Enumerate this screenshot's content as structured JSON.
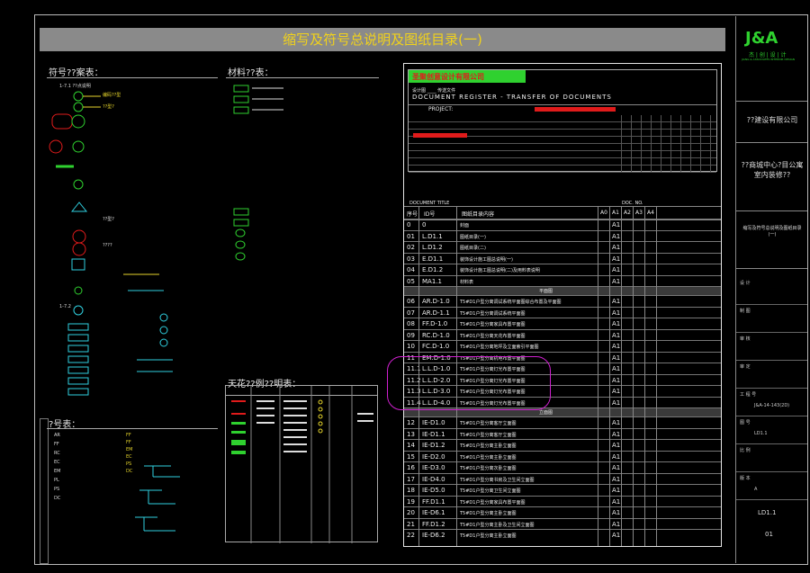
{
  "banner_title": "缩写及符号总说明及图纸目录(一)",
  "left": {
    "symbols_title": "符号??案表：",
    "materials_title": "材料??表：",
    "ceiling_title": "天花??例??明表：",
    "numbers_title": "?号表：",
    "sym_group_1": "1-7.1 ??点说明",
    "sym_group_2": "1-7.2",
    "sym_labels": [
      "编码??型",
      "??型?",
      "??型?",
      "????"
    ],
    "abbr_codes": [
      "AR",
      "FF",
      "RC",
      "EC",
      "EM",
      "PL",
      "PS",
      "DC"
    ],
    "abbr_codes_2": [
      "FF",
      "FF",
      "EM",
      "EC",
      "PS",
      "DC"
    ]
  },
  "register": {
    "company": "圣聚创意设计有限公司",
    "subtitle_cn": "设计图 ____ 传送文件",
    "title_en": "DOCUMENT REGISTER - TRANSFER OF DOCUMENTS",
    "project_label": "PROJECT:",
    "doc_title_label": "DOCUMENT TITLE",
    "doc_no_label": "DOC. NO.",
    "header_cols": [
      "序号",
      "ID号",
      "图纸目录内容",
      "A0",
      "A1",
      "A2",
      "A3",
      "A4"
    ],
    "rows": [
      {
        "n": "0",
        "id": "0",
        "desc": "封面",
        "size": "A1"
      },
      {
        "n": "01",
        "id": "L.D1.1",
        "desc": "图纸目录(一)",
        "size": "A1"
      },
      {
        "n": "02",
        "id": "L.D1.2",
        "desc": "图纸目录(二)",
        "size": "A1"
      },
      {
        "n": "03",
        "id": "E.D1.1",
        "desc": "装饰设计施工图总说明(一)",
        "size": "A1"
      },
      {
        "n": "04",
        "id": "E.D1.2",
        "desc": "装饰设计施工图总说明(二)及用料表说明",
        "size": "A1"
      },
      {
        "n": "05",
        "id": "MA1.1",
        "desc": "材料表",
        "size": "A1"
      },
      {
        "sep": "平面图"
      },
      {
        "n": "06",
        "id": "AR.D-1.0",
        "desc": "T5#D1户型分离调试系统平面图综合布置及平面图",
        "size": "A1"
      },
      {
        "n": "07",
        "id": "AR.D-1.1",
        "desc": "T5#D1户型分离调试系统平面图",
        "size": "A1"
      },
      {
        "n": "08",
        "id": "FF.D-1.0",
        "desc": "T5#D1户型分离家具布置平面图",
        "size": "A1"
      },
      {
        "n": "09",
        "id": "RC.D-1.0",
        "desc": "T5#D1户型分离天花布置平面图",
        "size": "A1"
      },
      {
        "n": "10",
        "id": "FC.D-1.0",
        "desc": "T5#D1户型分离地坪及立面索引平面图",
        "size": "A1"
      },
      {
        "n": "11",
        "id": "EM.D-1.0",
        "desc": "T5#D1户型分离机电布置平面图",
        "size": "A1"
      },
      {
        "n": "11.1",
        "id": "L.L.D-1.0",
        "desc": "T5#D1户型分离灯光布置平面图",
        "size": "A1"
      },
      {
        "n": "11.2",
        "id": "L.L.D-2.0",
        "desc": "T5#D1户型分离灯光布置平面图",
        "size": "A1"
      },
      {
        "n": "11.3",
        "id": "L.L.D-3.0",
        "desc": "T5#D1户型分离灯光布置平面图",
        "size": "A1"
      },
      {
        "n": "11.4",
        "id": "L.L.D-4.0",
        "desc": "T5#D1户型分离灯光布置平面图",
        "size": "A1"
      },
      {
        "sep": "立面图"
      },
      {
        "n": "12",
        "id": "IE-D1.0",
        "desc": "T5#D1户型分离客厅立面图",
        "size": "A1"
      },
      {
        "n": "13",
        "id": "IE-D1.1",
        "desc": "T5#D1户型分离客厅立面图",
        "size": "A1"
      },
      {
        "n": "14",
        "id": "IE-D1.2",
        "desc": "T5#D1户型分离主卧立面图",
        "size": "A1"
      },
      {
        "n": "15",
        "id": "IE-D2.0",
        "desc": "T5#D1户型分离主卧立面图",
        "size": "A1"
      },
      {
        "n": "16",
        "id": "IE-D3.0",
        "desc": "T5#D1户型分离次卧立面图",
        "size": "A1"
      },
      {
        "n": "17",
        "id": "IE-D4.0",
        "desc": "T5#D1户型分离书房及卫生间立面图",
        "size": "A1"
      },
      {
        "n": "18",
        "id": "IE-D5.0",
        "desc": "T5#D1户型分离卫生间立面图",
        "size": "A1"
      },
      {
        "n": "19",
        "id": "FF.D1.1",
        "desc": "T5#D1户型分离家具布置平面图",
        "size": "A1"
      },
      {
        "n": "20",
        "id": "IE-D6.1",
        "desc": "T5#D1户型分离主卧立面图",
        "size": "A1"
      },
      {
        "n": "21",
        "id": "FF.D1.2",
        "desc": "T5#D1户型分离主卧及卫生间立面图",
        "size": "A1"
      },
      {
        "n": "22",
        "id": "IE-D6.2",
        "desc": "T5#D1户型分离主卧立面图",
        "size": "A1"
      }
    ]
  },
  "titleblock": {
    "logo": "J&A",
    "firm": "杰 | 创 | 设 | 计",
    "firm_sub": "JIANG & ASSOCIATES INTERIOR DESIGN",
    "client": "??建设有限公司",
    "project": "??商城中心?目公寓室内装修??",
    "drawing_name": "缩写及符号总说明及图纸目录(一)",
    "labels": [
      "设 计",
      "制 图",
      "审 核",
      "审 定",
      "工 程 号",
      "图 号",
      "比 例",
      "版 本"
    ],
    "values": [
      "",
      "",
      "",
      "",
      "J&A-14-143(2D)",
      "LD1.1",
      "",
      "A"
    ],
    "sheet_no": "LD1.1",
    "rev": "01"
  },
  "colors": {
    "banner_bg": "#8a8a8a",
    "banner_text": "#f1d21b",
    "cloud": "#d020d0",
    "green": "#2fd12f",
    "red": "#e01b1b",
    "cyan": "#2fd0e0",
    "yellow": "#e6d52b"
  }
}
